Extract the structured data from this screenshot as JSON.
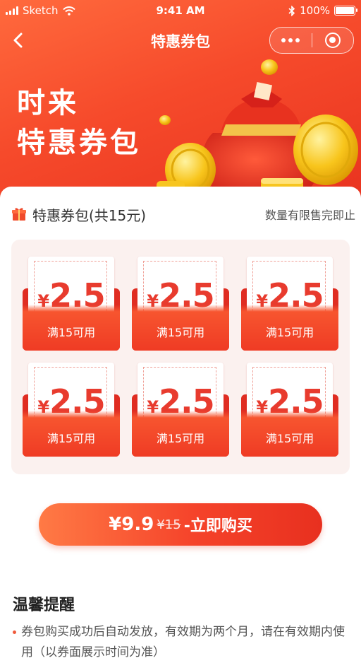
{
  "status_bar": {
    "carrier": "Sketch",
    "time": "9:41 AM",
    "battery": "100%"
  },
  "nav": {
    "title": "特惠券包"
  },
  "hero": {
    "line1": "时来",
    "line2": "特惠券包"
  },
  "package": {
    "title": "特惠券包(共15元)",
    "note": "数量有限售完即止"
  },
  "coupons": [
    {
      "currency": "¥",
      "amount": "2.5",
      "condition": "满15可用"
    },
    {
      "currency": "¥",
      "amount": "2.5",
      "condition": "满15可用"
    },
    {
      "currency": "¥",
      "amount": "2.5",
      "condition": "满15可用"
    },
    {
      "currency": "¥",
      "amount": "2.5",
      "condition": "满15可用"
    },
    {
      "currency": "¥",
      "amount": "2.5",
      "condition": "满15可用"
    },
    {
      "currency": "¥",
      "amount": "2.5",
      "condition": "满15可用"
    }
  ],
  "buy": {
    "price": "¥9.9",
    "original_price": "¥15",
    "label": "-立即购买"
  },
  "tips": {
    "title": "温馨提醒",
    "items": [
      "券包购买成功后自动发放，有效期为两个月，请在有效期内使用（以券面展示时间为准）"
    ]
  },
  "colors": {
    "brand_red": "#f04a2b",
    "coupon_red": "#e83b2e",
    "panel_bg": "#fbf1ef"
  }
}
